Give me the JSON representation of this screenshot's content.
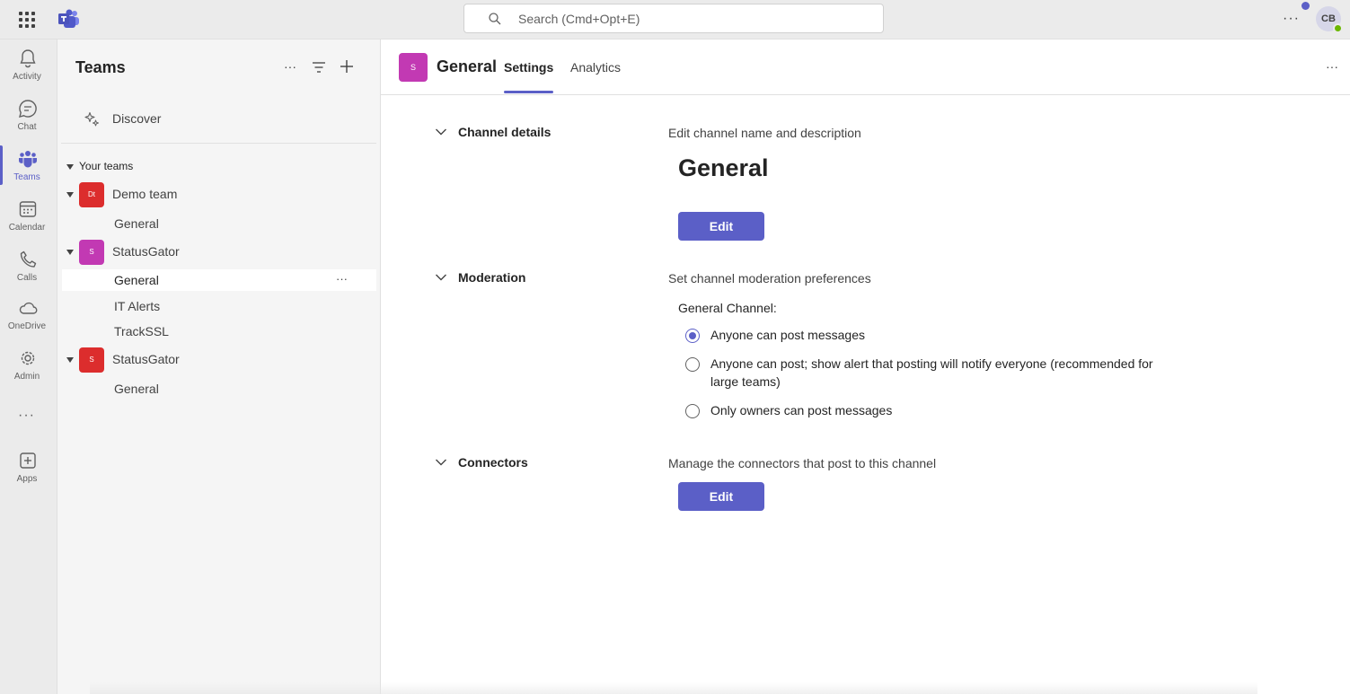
{
  "topbar": {
    "search_placeholder": "Search (Cmd+Opt+E)",
    "more": "···",
    "avatar_initials": "CB"
  },
  "rail": {
    "items": [
      {
        "label": "Activity"
      },
      {
        "label": "Chat"
      },
      {
        "label": "Teams"
      },
      {
        "label": "Calendar"
      },
      {
        "label": "Calls"
      },
      {
        "label": "OneDrive"
      },
      {
        "label": "Admin"
      },
      {
        "label": "Apps"
      }
    ],
    "more": "···"
  },
  "teams_panel": {
    "title": "Teams",
    "more": "···",
    "discover": "Discover",
    "section": "Your teams",
    "teams": [
      {
        "name": "Demo team",
        "badge": "Dt",
        "color": "#dc2d2d",
        "channels": [
          "General"
        ]
      },
      {
        "name": "StatusGator",
        "badge": "S",
        "color": "#c239b3",
        "channels": [
          "General",
          "IT Alerts",
          "TrackSSL"
        ]
      },
      {
        "name": "StatusGator",
        "badge": "S",
        "color": "#dc2d2d",
        "channels": [
          "General"
        ]
      }
    ],
    "selected_more": "···"
  },
  "main": {
    "badge": "S",
    "channel_title": "General",
    "tabs": [
      {
        "label": "Settings"
      },
      {
        "label": "Analytics"
      }
    ],
    "more": "···",
    "sections": {
      "details": {
        "title": "Channel details",
        "description": "Edit channel name and description",
        "name": "General",
        "button": "Edit"
      },
      "moderation": {
        "title": "Moderation",
        "description": "Set channel moderation preferences",
        "group_label": "General Channel:",
        "options": [
          "Anyone can post messages",
          "Anyone can post; show alert that posting will notify everyone (recommended for large teams)",
          "Only owners can post messages"
        ]
      },
      "connectors": {
        "title": "Connectors",
        "description": "Manage the connectors that post to this channel",
        "button": "Edit"
      }
    }
  },
  "colors": {
    "accent": "#5b5fc7",
    "badge_red": "#dc2d2d",
    "badge_magenta": "#c239b3"
  }
}
